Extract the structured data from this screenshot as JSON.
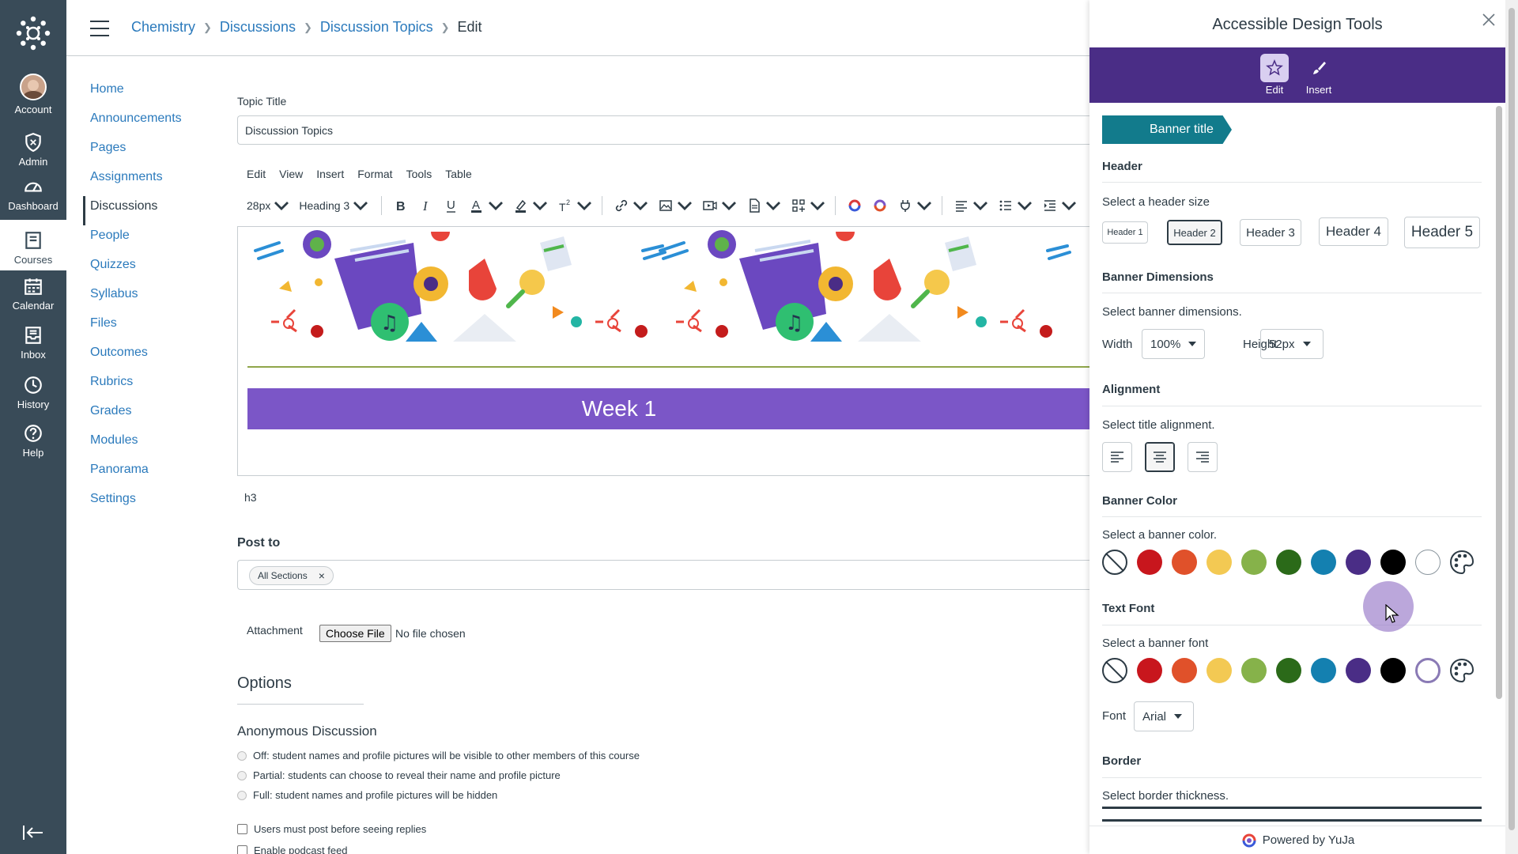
{
  "global_nav": {
    "items": [
      {
        "label": "Account",
        "icon": "avatar"
      },
      {
        "label": "Admin",
        "icon": "shield-icon"
      },
      {
        "label": "Dashboard",
        "icon": "dashboard-icon"
      },
      {
        "label": "Courses",
        "icon": "courses-icon"
      },
      {
        "label": "Calendar",
        "icon": "calendar-icon"
      },
      {
        "label": "Inbox",
        "icon": "inbox-icon"
      },
      {
        "label": "History",
        "icon": "clock-icon"
      },
      {
        "label": "Help",
        "icon": "help-icon"
      }
    ],
    "active": "Courses"
  },
  "breadcrumb": {
    "items": [
      "Chemistry",
      "Discussions",
      "Discussion Topics"
    ],
    "current": "Edit"
  },
  "course_nav": {
    "items": [
      "Home",
      "Announcements",
      "Pages",
      "Assignments",
      "Discussions",
      "People",
      "Quizzes",
      "Syllabus",
      "Files",
      "Outcomes",
      "Rubrics",
      "Grades",
      "Modules",
      "Panorama",
      "Settings"
    ],
    "active": "Discussions"
  },
  "form": {
    "topic_title_label": "Topic Title",
    "topic_title_value": "Discussion Topics",
    "editor_menu": [
      "Edit",
      "View",
      "Insert",
      "Format",
      "Tools",
      "Table"
    ],
    "font_size": "28px",
    "block_format": "Heading 3",
    "banner_text": "Week 1",
    "path": "h3",
    "post_to_label": "Post to",
    "post_to_chip": "All Sections",
    "attachment_label": "Attachment",
    "choose_file": "Choose File",
    "no_file": "No file chosen",
    "options_heading": "Options",
    "anonymous_heading": "Anonymous Discussion",
    "anonymous_options": [
      "Off: student names and profile pictures will be visible to other members of this course",
      "Partial: students can choose to reveal their name and profile picture",
      "Full: student names and profile pictures will be hidden"
    ],
    "checkboxes": [
      "Users must post before seeing replies",
      "Enable podcast feed"
    ]
  },
  "panel": {
    "title": "Accessible Design Tools",
    "tabs": [
      "Edit",
      "Insert"
    ],
    "active_tab": "Edit",
    "crumb": "Banner title",
    "header_section": "Header",
    "header_prompt": "Select a header size",
    "header_sizes": [
      "Header 1",
      "Header 2",
      "Header 3",
      "Header 4",
      "Header 5"
    ],
    "header_selected": "Header 2",
    "dimensions_section": "Banner Dimensions",
    "dimensions_prompt": "Select banner dimensions.",
    "width_label": "Width",
    "width_value": "100%",
    "height_label": "Height",
    "height_value": "52px",
    "alignment_section": "Alignment",
    "alignment_prompt": "Select title alignment.",
    "alignment_selected": "center",
    "banner_color_section": "Banner Color",
    "banner_color_prompt": "Select a banner color.",
    "text_font_section": "Text Font",
    "text_font_prompt": "Select a banner font",
    "font_label": "Font",
    "font_value": "Arial",
    "border_section": "Border",
    "border_prompt": "Select border thickness.",
    "footer": "Powered by YuJa",
    "swatch_colors": [
      "#c8161d",
      "#e0512a",
      "#f3c953",
      "#86b24a",
      "#2b6a19",
      "#1480b0",
      "#4a2d86",
      "#000000"
    ]
  },
  "colors": {
    "nav_bg": "#394b58",
    "link": "#2b7abc",
    "panel_bar": "#4a2d86",
    "crumb": "#127b8c",
    "banner": "#7b56c7"
  }
}
